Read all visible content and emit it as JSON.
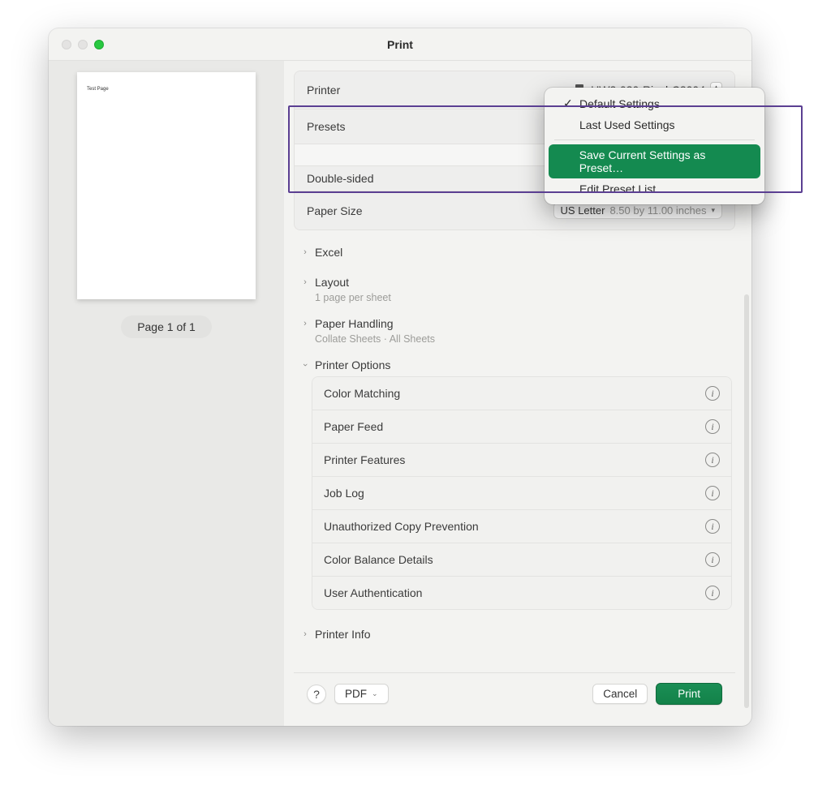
{
  "window_title": "Print",
  "preview": {
    "content": "Test Page",
    "page_indicator": "Page 1 of 1"
  },
  "settings": {
    "printer": {
      "label": "Printer",
      "value": "UW2-030-RicohC3004"
    },
    "presets": {
      "label": "Presets"
    },
    "double_sided": {
      "label": "Double-sided"
    },
    "paper_size": {
      "label": "Paper Size",
      "value": "US Letter",
      "dimensions": "8.50 by 11.00 inches"
    }
  },
  "presets_menu": {
    "default": "Default Settings",
    "last_used": "Last Used Settings",
    "save_as": "Save Current Settings as Preset…",
    "edit_list": "Edit Preset List…"
  },
  "sections": {
    "excel": {
      "label": "Excel"
    },
    "layout": {
      "label": "Layout",
      "sub": "1 page per sheet"
    },
    "paper_handling": {
      "label": "Paper Handling",
      "sub": "Collate Sheets · All Sheets"
    },
    "printer_options": {
      "label": "Printer Options"
    },
    "printer_info": {
      "label": "Printer Info"
    }
  },
  "printer_options": [
    "Color Matching",
    "Paper Feed",
    "Printer Features",
    "Job Log",
    "Unauthorized Copy Prevention",
    "Color Balance Details",
    "User Authentication"
  ],
  "footer": {
    "help": "?",
    "pdf": "PDF",
    "cancel": "Cancel",
    "print": "Print"
  }
}
